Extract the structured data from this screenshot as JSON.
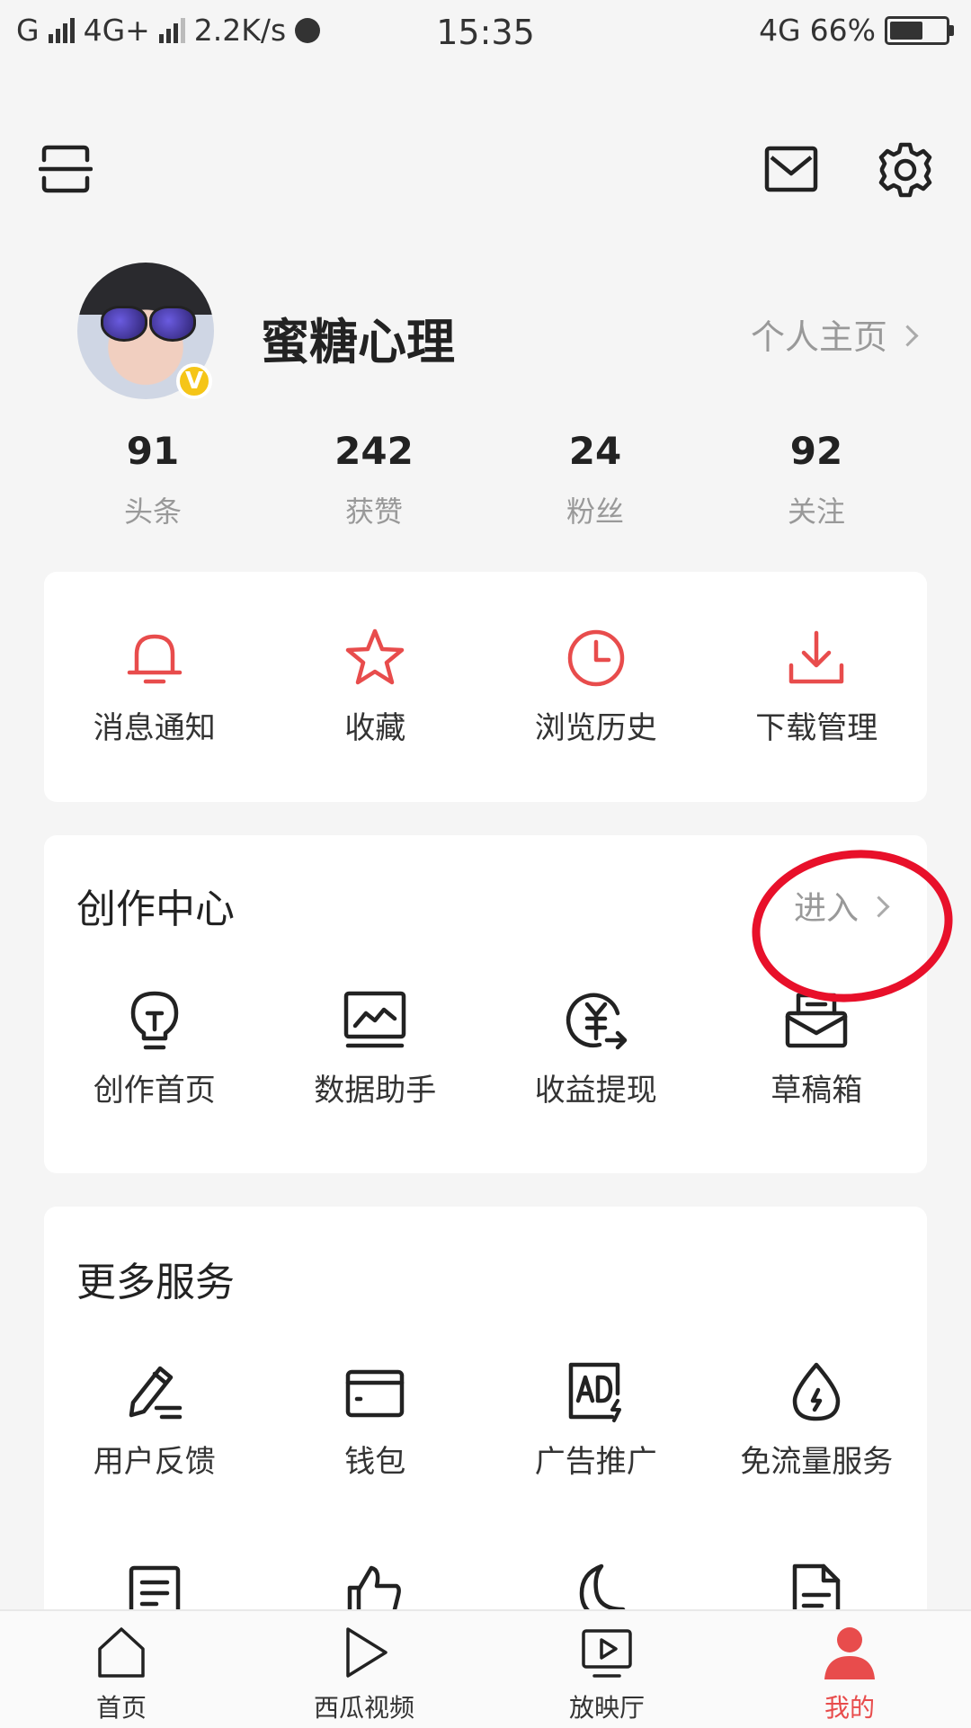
{
  "status_bar": {
    "carrier1": "G",
    "net2": "4G+",
    "speed": "2.2K/s",
    "time": "15:35",
    "net_right": "4G",
    "battery_pct": "66%",
    "battery_level": 0.66
  },
  "profile": {
    "name": "蜜糖心理",
    "profile_link": "个人主页",
    "badge": "V"
  },
  "stats": [
    {
      "num": "91",
      "label": "头条"
    },
    {
      "num": "242",
      "label": "获赞"
    },
    {
      "num": "24",
      "label": "粉丝"
    },
    {
      "num": "92",
      "label": "关注"
    }
  ],
  "quick_actions": [
    {
      "label": "消息通知",
      "icon": "bell-icon"
    },
    {
      "label": "收藏",
      "icon": "star-icon"
    },
    {
      "label": "浏览历史",
      "icon": "clock-icon"
    },
    {
      "label": "下载管理",
      "icon": "download-icon"
    }
  ],
  "creation_center": {
    "title": "创作中心",
    "enter": "进入",
    "items": [
      {
        "label": "创作首页",
        "icon": "lightbulb-icon"
      },
      {
        "label": "数据助手",
        "icon": "chart-monitor-icon"
      },
      {
        "label": "收益提现",
        "icon": "yen-withdraw-icon"
      },
      {
        "label": "草稿箱",
        "icon": "drafts-box-icon"
      }
    ]
  },
  "more_services": {
    "title": "更多服务",
    "items": [
      {
        "label": "用户反馈",
        "icon": "pencil-icon"
      },
      {
        "label": "钱包",
        "icon": "wallet-icon"
      },
      {
        "label": "广告推广",
        "icon": "ad-icon"
      },
      {
        "label": "免流量服务",
        "icon": "data-drop-icon"
      }
    ]
  },
  "bottom_nav": [
    {
      "label": "首页",
      "icon": "home-icon",
      "active": false
    },
    {
      "label": "西瓜视频",
      "icon": "play-icon",
      "active": false
    },
    {
      "label": "放映厅",
      "icon": "tv-play-icon",
      "active": false
    },
    {
      "label": "我的",
      "icon": "person-icon",
      "active": true
    }
  ],
  "colors": {
    "accent": "#e84c4c",
    "annotation": "#e8102a"
  }
}
